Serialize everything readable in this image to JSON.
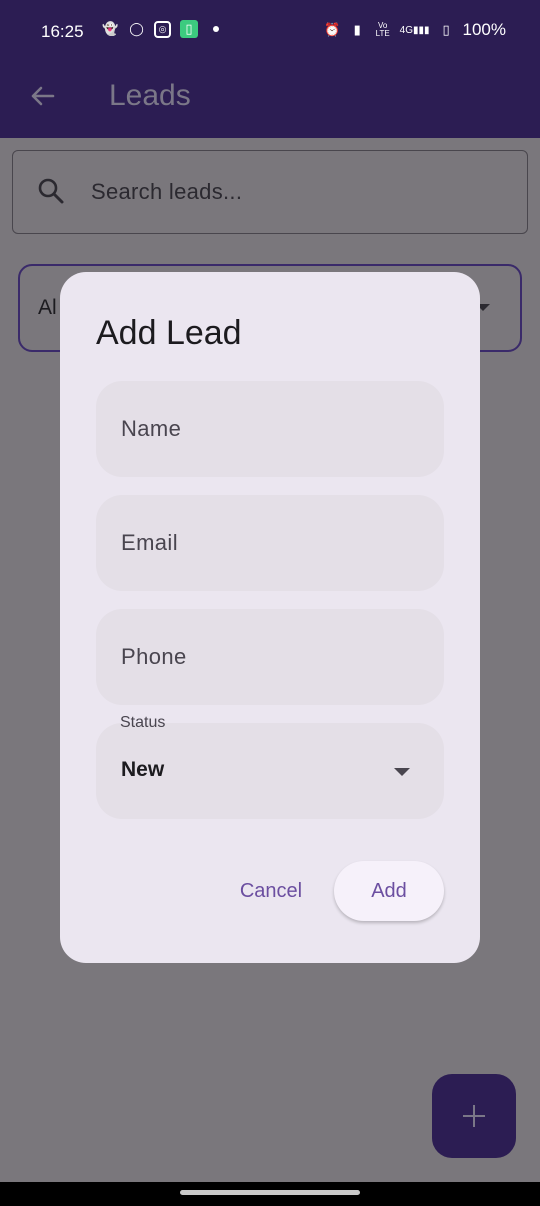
{
  "status_bar": {
    "time": "16:25",
    "icons_left": [
      "snapchat-icon",
      "whatsapp-icon",
      "instagram-icon",
      "app-icon",
      "dot-icon"
    ],
    "icons_right": [
      "alarm-icon",
      "vibrate-icon",
      "volte-icon",
      "signal-4g-icon",
      "battery-icon"
    ],
    "volte_label": "Vo LTE",
    "network_label": "4G",
    "battery": "100%"
  },
  "app_bar": {
    "title": "Leads"
  },
  "search": {
    "placeholder": "Search leads..."
  },
  "filter": {
    "selected_partial": "Al"
  },
  "dialog": {
    "title": "Add Lead",
    "fields": {
      "name_placeholder": "Name",
      "email_placeholder": "Email",
      "phone_placeholder": "Phone",
      "status_label": "Status",
      "status_value": "New"
    },
    "cancel_label": "Cancel",
    "add_label": "Add"
  },
  "colors": {
    "primary_dark": "#2c1d53",
    "accent": "#6b4ea0",
    "dialog_bg": "#ebe6f0",
    "field_bg": "#e4dfe7",
    "scrim": "#7a777c"
  }
}
